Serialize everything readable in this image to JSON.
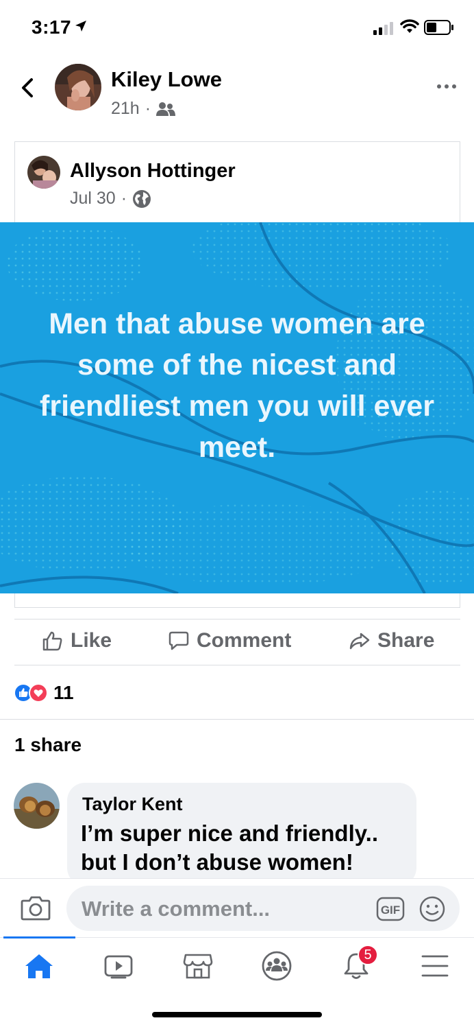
{
  "status_bar": {
    "time": "3:17"
  },
  "header": {
    "author_name": "Kiley Lowe",
    "timestamp": "21h",
    "separator": "·",
    "audience_icon": "friends-icon"
  },
  "shared_post": {
    "author_name": "Allyson Hottinger",
    "date": "Jul 30",
    "separator": "·",
    "audience_icon": "globe-icon",
    "quote": "Men that abuse women are some of the nicest and friendliest men you will ever meet.",
    "image_bg_color": "#1aa0e0"
  },
  "actions": {
    "like_label": "Like",
    "comment_label": "Comment",
    "share_label": "Share"
  },
  "reactions": {
    "types": [
      "like",
      "love"
    ],
    "count": "11"
  },
  "shares": {
    "label": "1 share"
  },
  "comment": {
    "author": "Taylor Kent",
    "text": "I’m super nice and friendly.. but I don’t abuse women!"
  },
  "composer": {
    "placeholder": "Write a comment...",
    "gif_label": "GIF"
  },
  "nav": {
    "items": [
      "home",
      "watch",
      "marketplace",
      "groups",
      "notifications",
      "menu"
    ],
    "active": "home",
    "notification_badge": "5"
  },
  "colors": {
    "accent": "#1877f2",
    "secondary_text": "#65676b",
    "badge": "#e41e3f"
  }
}
